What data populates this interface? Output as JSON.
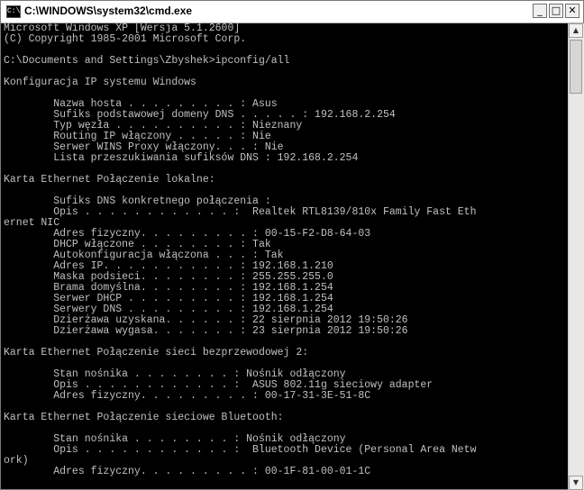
{
  "window": {
    "title": "C:\\WINDOWS\\system32\\cmd.exe",
    "icon": "cmd-icon",
    "buttons": {
      "minimize": "_",
      "maximize": "□",
      "close": "✕"
    }
  },
  "scrollbar": {
    "up": "▲",
    "down": "▼"
  },
  "console": {
    "lines": [
      "Microsoft Windows XP [Wersja 5.1.2600]",
      "(C) Copyright 1985-2001 Microsoft Corp.",
      "",
      "C:\\Documents and Settings\\Zbyshek>ipconfig/all",
      "",
      "Konfiguracja IP systemu Windows",
      "",
      "        Nazwa hosta . . . . . . . . . : Asus",
      "        Sufiks podstawowej domeny DNS . . . . . : 192.168.2.254",
      "        Typ węzła . . . . . . . . . . : Nieznany",
      "        Routing IP włączony . . . . . : Nie",
      "        Serwer WINS Proxy włączony. . . : Nie",
      "        Lista przeszukiwania sufiksów DNS : 192.168.2.254",
      "",
      "Karta Ethernet Połączenie lokalne:",
      "",
      "        Sufiks DNS konkretnego połączenia :",
      "        Opis . . . . . . . . . . . . :  Realtek RTL8139/810x Family Fast Eth",
      "ernet NIC",
      "        Adres fizyczny. . . . . . . . . : 00-15-F2-D8-64-03",
      "        DHCP włączone . . . . . . . . : Tak",
      "        Autokonfiguracja włączona . . . : Tak",
      "        Adres IP. . . . . . . . . . . : 192.168.1.210",
      "        Maska podsieci. . . . . . . . : 255.255.255.0",
      "        Brama domyślna. . . . . . . . : 192.168.1.254",
      "        Serwer DHCP . . . . . . . . . : 192.168.1.254",
      "        Serwery DNS . . . . . . . . . : 192.168.1.254",
      "        Dzierżawa uzyskana. . . . . . : 22 sierpnia 2012 19:50:26",
      "        Dzierżawa wygasa. . . . . . . : 23 sierpnia 2012 19:50:26",
      "",
      "Karta Ethernet Połączenie sieci bezprzewodowej 2:",
      "",
      "        Stan nośnika . . . . . . . . : Nośnik odłączony",
      "        Opis . . . . . . . . . . . . :  ASUS 802.11g sieciowy adapter",
      "        Adres fizyczny. . . . . . . . . : 00-17-31-3E-51-8C",
      "",
      "Karta Ethernet Połączenie sieciowe Bluetooth:",
      "",
      "        Stan nośnika . . . . . . . . : Nośnik odłączony",
      "        Opis . . . . . . . . . . . . :  Bluetooth Device (Personal Area Netw",
      "ork)",
      "        Adres fizyczny. . . . . . . . . : 00-1F-81-00-01-1C"
    ]
  }
}
